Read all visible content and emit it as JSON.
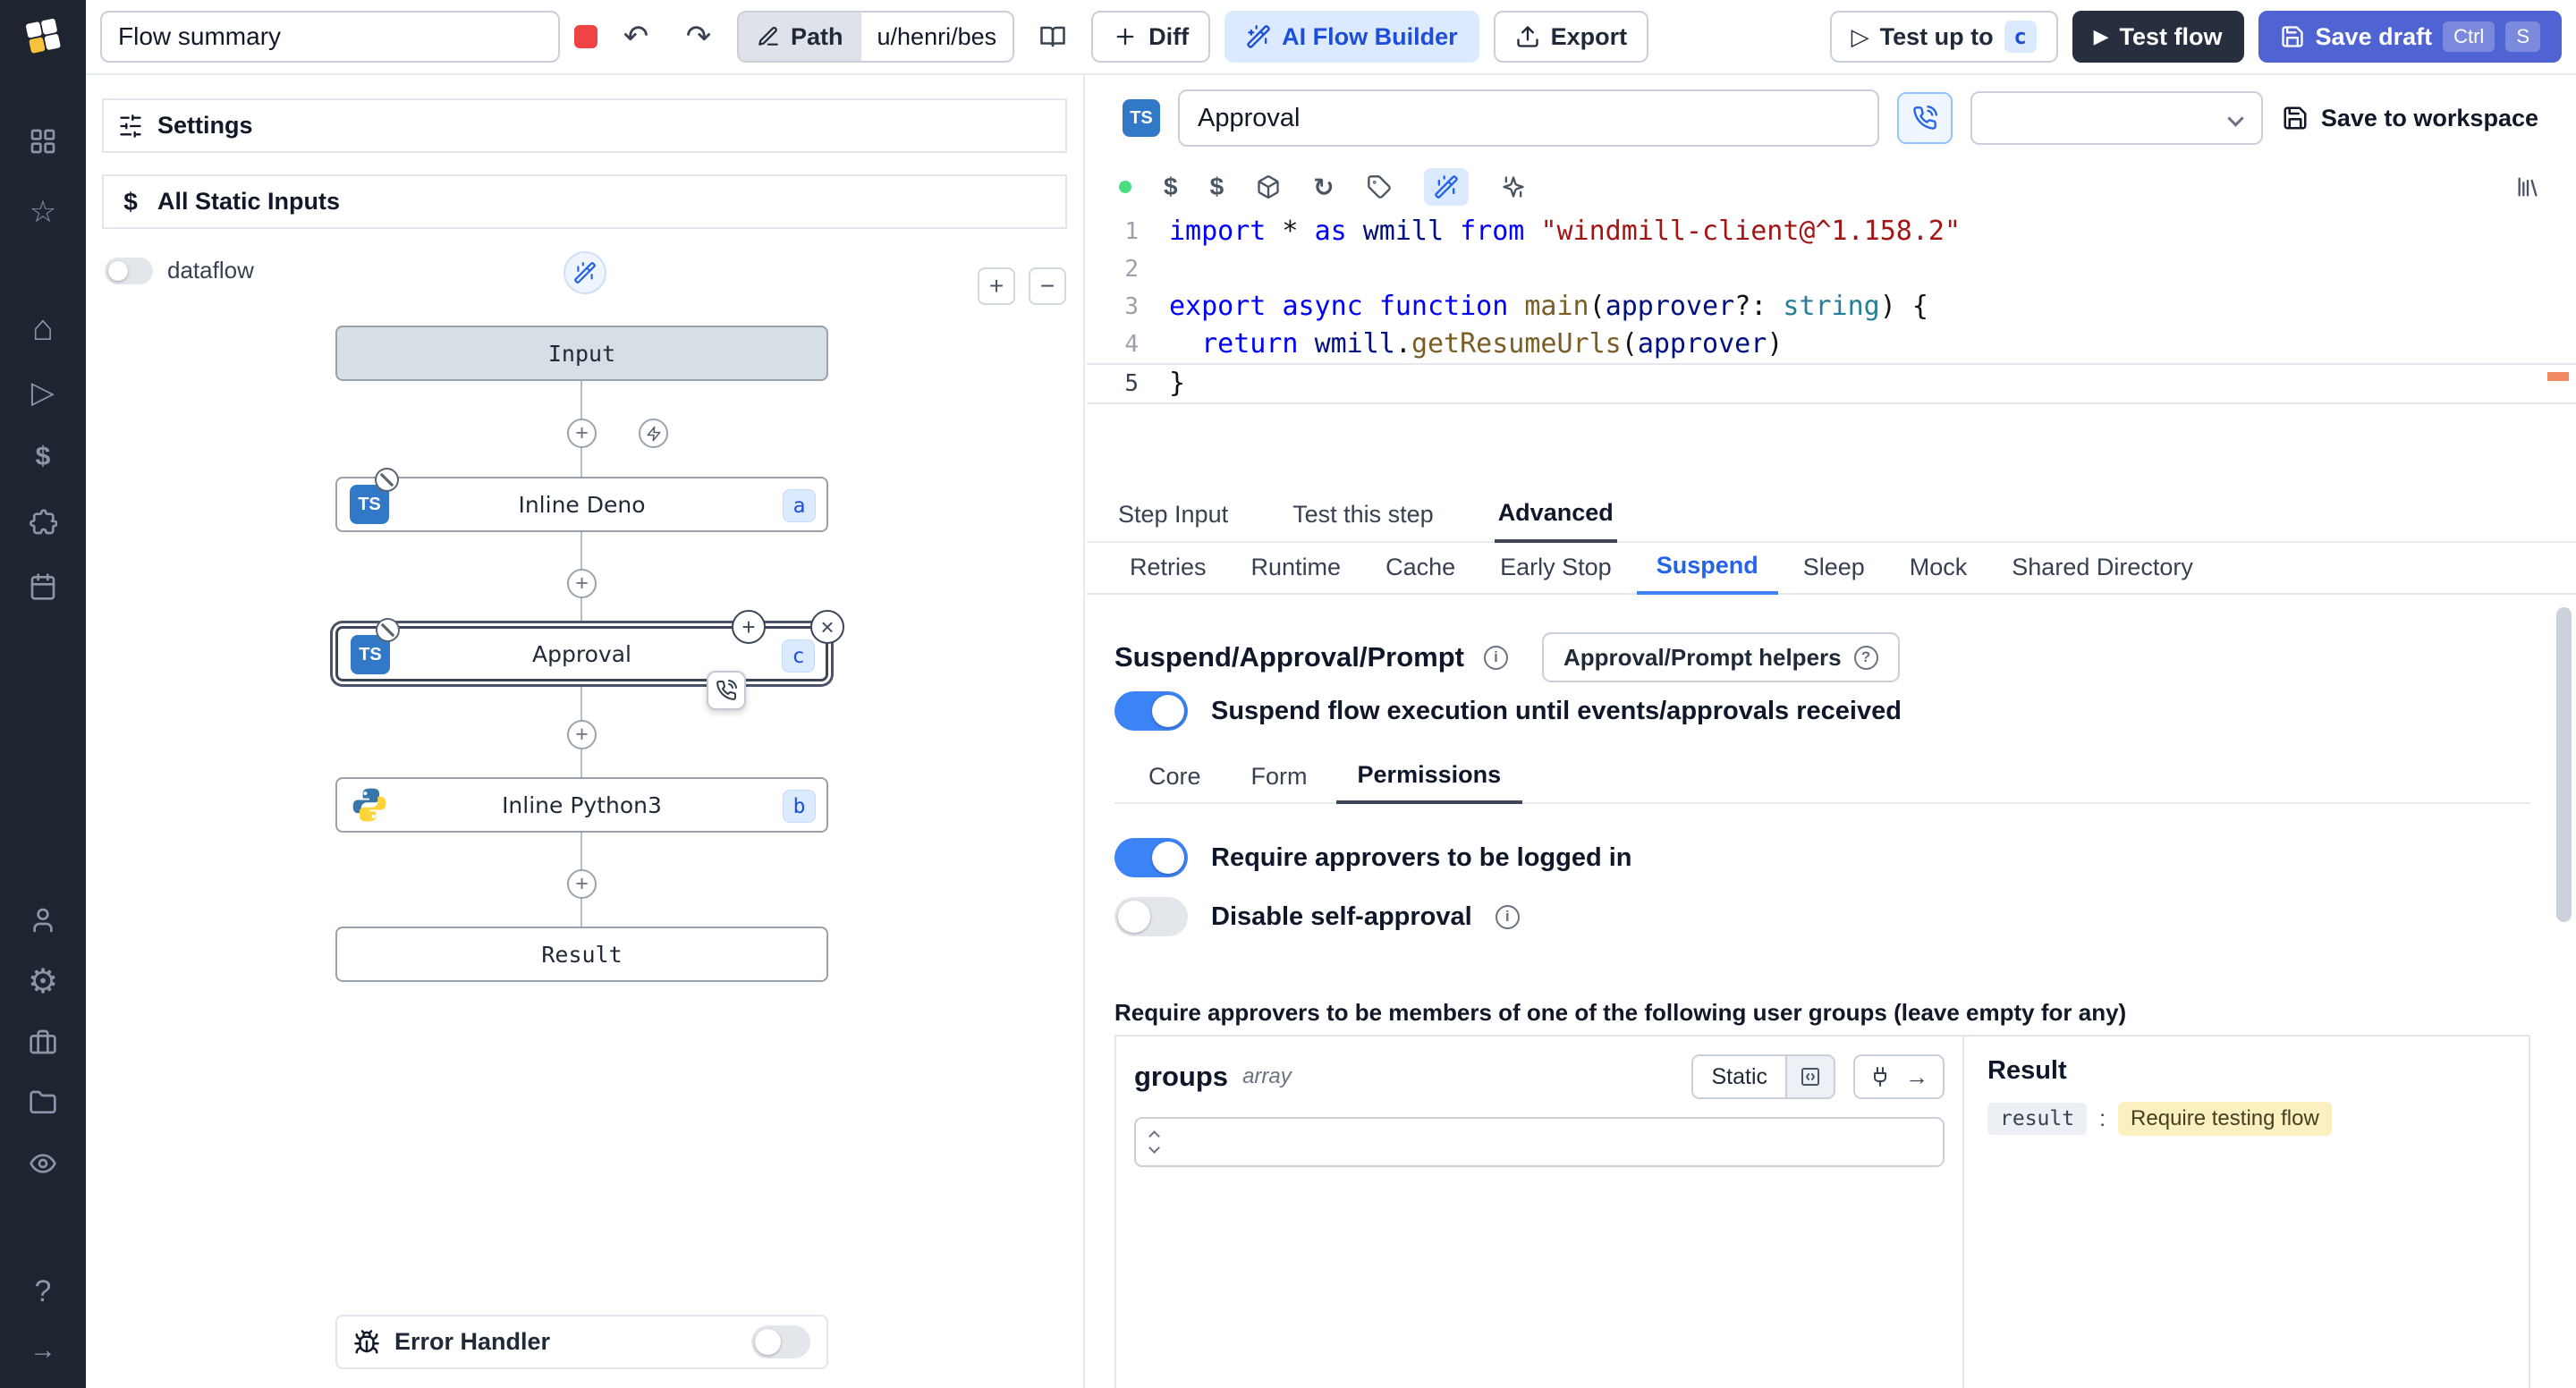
{
  "icons": {
    "undo": "↶",
    "redo": "↷",
    "plus": "+",
    "minus": "−",
    "close": "×",
    "dollar": "$",
    "refresh": "↻",
    "arrow_right": "→",
    "question": "?",
    "info": "i",
    "play": "▷",
    "play_filled": "▶",
    "star": "☆",
    "home": "⌂",
    "gear": "⚙"
  },
  "topbar": {
    "flow_summary_value": "Flow summary",
    "path_label": "Path",
    "path_value": "u/henri/bes",
    "diff_label": "Diff",
    "ai_flow_builder_label": "AI Flow Builder",
    "export_label": "Export",
    "test_up_to_label": "Test up to",
    "test_up_to_badge": "c",
    "test_flow_label": "Test flow",
    "save_draft_label": "Save draft",
    "kbd_ctrl": "Ctrl",
    "kbd_s": "S"
  },
  "flow_panel": {
    "settings_label": "Settings",
    "static_inputs_label": "All Static Inputs",
    "dataflow_label": "dataflow",
    "error_handler_label": "Error Handler",
    "nodes": {
      "input": "Input",
      "deno": {
        "label": "Inline Deno",
        "badge": "a"
      },
      "approval": {
        "label": "Approval",
        "badge": "c"
      },
      "python": {
        "label": "Inline Python3",
        "badge": "b"
      },
      "result": "Result"
    }
  },
  "editor": {
    "step_name": "Approval",
    "language_badge": "TS",
    "save_to_workspace_label": "Save to workspace",
    "code": {
      "active_line": 5,
      "lines": [
        [
          [
            "kw",
            "import"
          ],
          [
            "pl",
            " * "
          ],
          [
            "kw",
            "as"
          ],
          [
            "pl",
            " "
          ],
          [
            "var",
            "wmill"
          ],
          [
            "pl",
            " "
          ],
          [
            "kw",
            "from"
          ],
          [
            "pl",
            " "
          ],
          [
            "str",
            "\"windmill-client@^1.158.2\""
          ]
        ],
        [],
        [
          [
            "kw",
            "export"
          ],
          [
            "pl",
            " "
          ],
          [
            "kw",
            "async"
          ],
          [
            "pl",
            " "
          ],
          [
            "kw",
            "function"
          ],
          [
            "pl",
            " "
          ],
          [
            "fn",
            "main"
          ],
          [
            "pl",
            "("
          ],
          [
            "var",
            "approver"
          ],
          [
            "pl",
            "?: "
          ],
          [
            "type",
            "string"
          ],
          [
            "pl",
            ") {"
          ]
        ],
        [
          [
            "pl",
            "  "
          ],
          [
            "kw",
            "return"
          ],
          [
            "pl",
            " "
          ],
          [
            "var",
            "wmill"
          ],
          [
            "pl",
            "."
          ],
          [
            "fn",
            "getResumeUrls"
          ],
          [
            "pl",
            "("
          ],
          [
            "var",
            "approver"
          ],
          [
            "pl",
            ")"
          ]
        ],
        [
          [
            "pl",
            "}"
          ]
        ]
      ]
    },
    "tabs": [
      "Step Input",
      "Test this step",
      "Advanced"
    ],
    "advanced_tabs": [
      "Retries",
      "Runtime",
      "Cache",
      "Early Stop",
      "Suspend",
      "Sleep",
      "Mock",
      "Shared Directory"
    ]
  },
  "suspend": {
    "title": "Suspend/Approval/Prompt",
    "helpers_label": "Approval/Prompt helpers",
    "suspend_toggle_label": "Suspend flow execution until events/approvals received",
    "perm_tabs": [
      "Core",
      "Form",
      "Permissions"
    ],
    "logged_in_label": "Require approvers to be logged in",
    "self_approval_label": "Disable self-approval",
    "groups_note": "Require approvers to be members of one of the following user groups (leave empty for any)",
    "groups_field": {
      "name": "groups",
      "type": "array",
      "static_label": "Static"
    },
    "result_panel": {
      "title": "Result",
      "key": "result",
      "value": "Require testing flow"
    }
  }
}
